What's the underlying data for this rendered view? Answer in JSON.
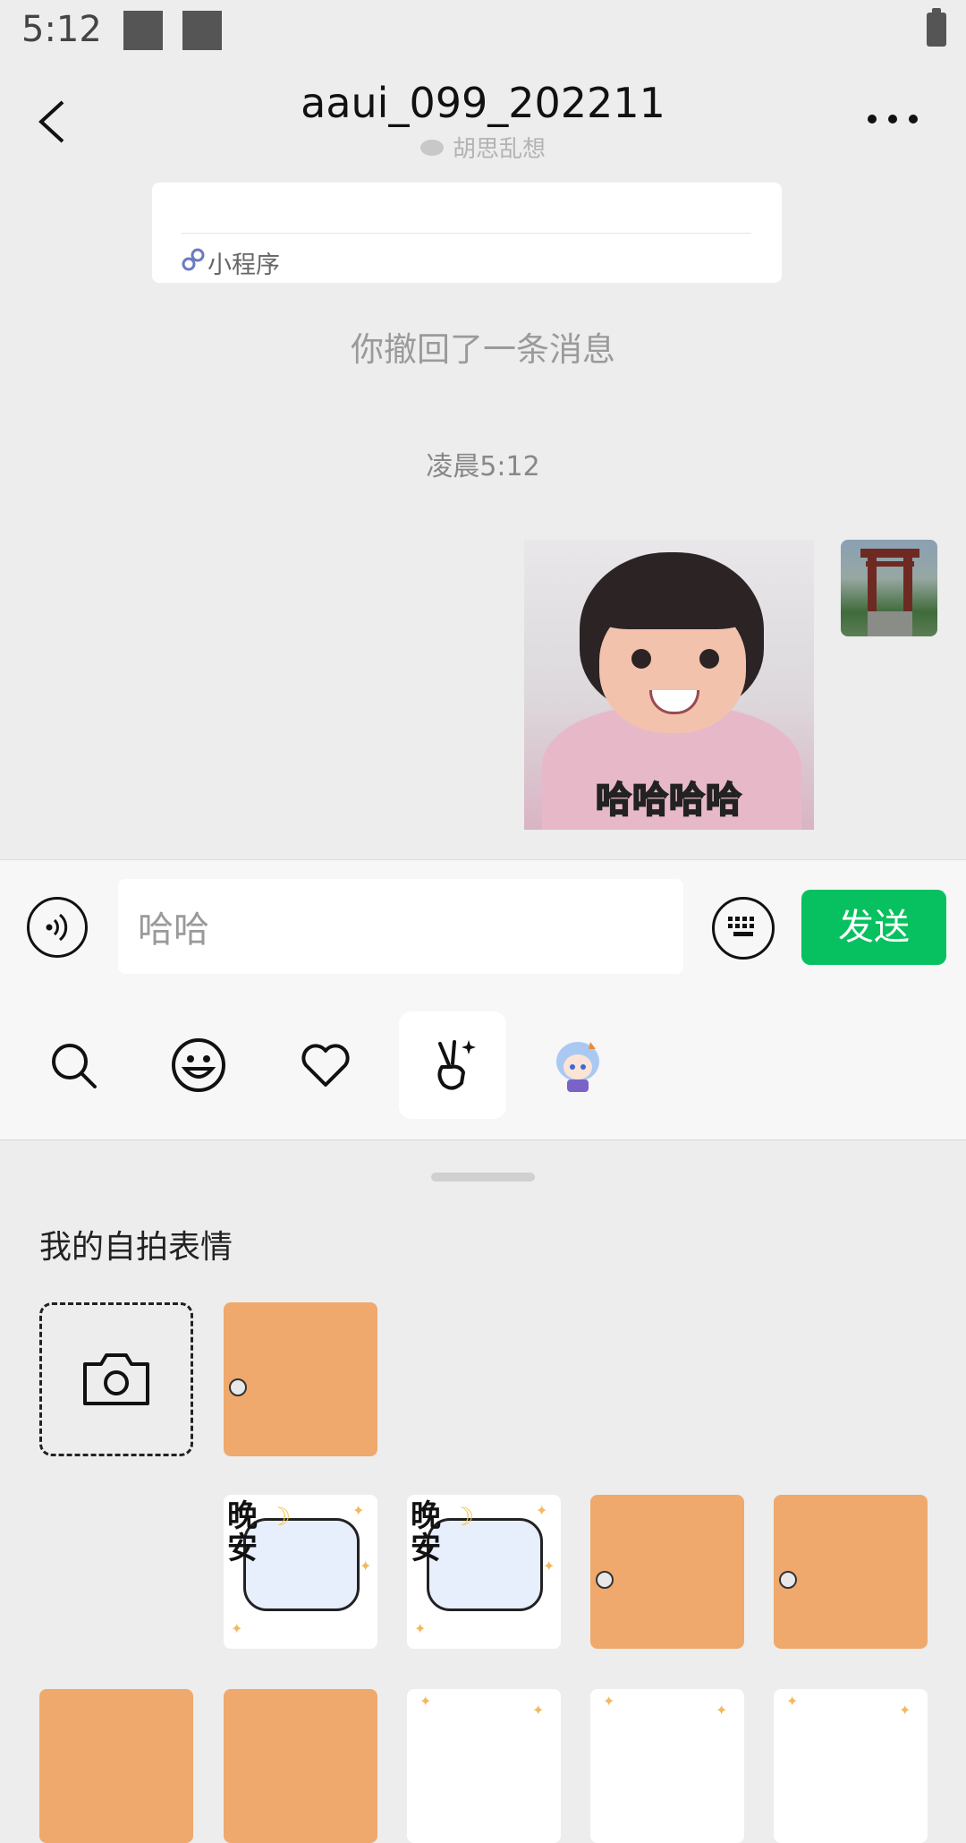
{
  "status_bar": {
    "time": "5:12"
  },
  "header": {
    "title": "aaui_099_202211",
    "subtitle": "胡思乱想"
  },
  "chat": {
    "mini_program_label": "小程序",
    "recall_notice": "你撤回了一条消息",
    "timestamp": "凌晨5:12",
    "sticker_caption": "哈哈哈哈"
  },
  "input": {
    "value": "哈哈",
    "send_label": "发送"
  },
  "emoji_tabs": [
    {
      "name": "search-icon"
    },
    {
      "name": "smiley-icon"
    },
    {
      "name": "heart-icon"
    },
    {
      "name": "gesture-icon",
      "active": true
    },
    {
      "name": "anime-sticker-icon"
    }
  ],
  "panel": {
    "section_title": "我的自拍表情",
    "sticker_text": "晚安"
  },
  "colors": {
    "send_green": "#07c160",
    "sticker_orange": "#f0a96c",
    "background": "#ededed"
  }
}
